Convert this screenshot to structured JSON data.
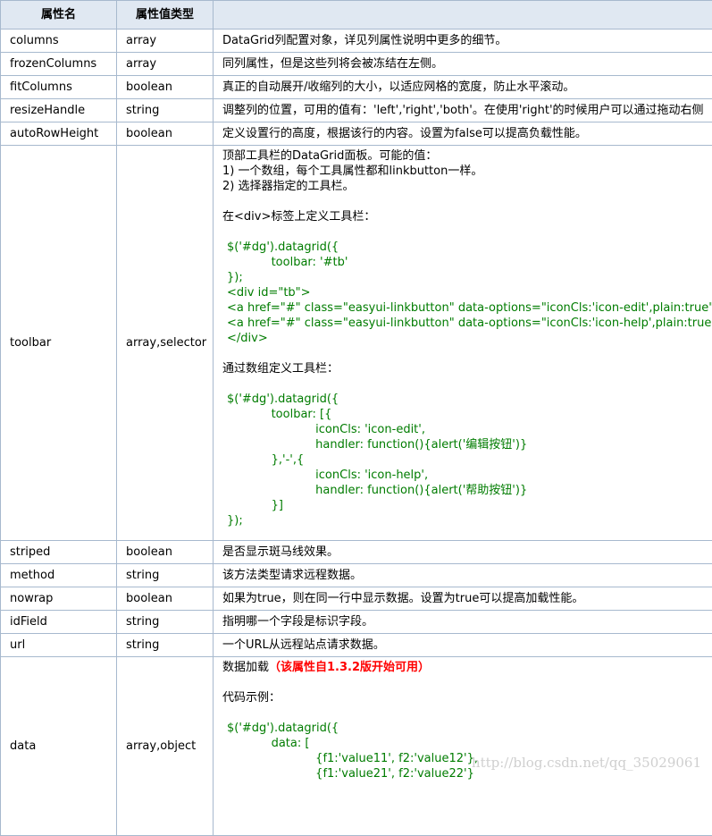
{
  "headers": {
    "name": "属性名",
    "type": "属性值类型",
    "desc": ""
  },
  "rows": [
    {
      "name": "columns",
      "type": "array",
      "desc": "DataGrid列配置对象，详见列属性说明中更多的细节。"
    },
    {
      "name": "frozenColumns",
      "type": "array",
      "desc": "同列属性，但是这些列将会被冻结在左侧。"
    },
    {
      "name": "fitColumns",
      "type": "boolean",
      "desc": "真正的自动展开/收缩列的大小，以适应网格的宽度，防止水平滚动。"
    },
    {
      "name": "resizeHandle",
      "type": "string",
      "desc": "调整列的位置，可用的值有：'left','right','both'。在使用'right'的时候用户可以通过拖动右侧"
    },
    {
      "name": "autoRowHeight",
      "type": "boolean",
      "desc": "定义设置行的高度，根据该行的内容。设置为false可以提高负载性能。"
    }
  ],
  "toolbar": {
    "name": "toolbar",
    "type": "array,selector",
    "lines": [
      "顶部工具栏的DataGrid面板。可能的值：",
      "1) 一个数组，每个工具属性都和linkbutton一样。",
      "2) 选择器指定的工具栏。"
    ],
    "div_heading": "在<div>标签上定义工具栏：",
    "code1": "$('#dg').datagrid({\n            toolbar: '#tb'\n});\n<div id=\"tb\">\n<a href=\"#\" class=\"easyui-linkbutton\" data-options=\"iconCls:'icon-edit',plain:true\"/a>\n<a href=\"#\" class=\"easyui-linkbutton\" data-options=\"iconCls:'icon-help',plain:true\"/a>\n</div>",
    "array_heading": "通过数组定义工具栏：",
    "code2": "$('#dg').datagrid({\n            toolbar: [{\n                        iconCls: 'icon-edit',\n                        handler: function(){alert('编辑按钮')}\n            },'-',{\n                        iconCls: 'icon-help',\n                        handler: function(){alert('帮助按钮')}\n            }]\n});"
  },
  "rows2": [
    {
      "name": "striped",
      "type": "boolean",
      "desc": "是否显示斑马线效果。"
    },
    {
      "name": "method",
      "type": "string",
      "desc": "该方法类型请求远程数据。"
    },
    {
      "name": "nowrap",
      "type": "boolean",
      "desc": "如果为true，则在同一行中显示数据。设置为true可以提高加载性能。"
    },
    {
      "name": "idField",
      "type": "string",
      "desc": "指明哪一个字段是标识字段。"
    },
    {
      "name": "url",
      "type": "string",
      "desc": "一个URL从远程站点请求数据。"
    }
  ],
  "data_row": {
    "name": "data",
    "type": "array,object",
    "intro": "数据加载",
    "note": "（该属性自1.3.2版开始可用）",
    "example_heading": "代码示例：",
    "code": "$('#dg').datagrid({\n            data: [\n                        {f1:'value11', f2:'value12'},\n                        {f1:'value21', f2:'value22'}"
  },
  "watermark": "http://blog.csdn.net/qq_35029061"
}
